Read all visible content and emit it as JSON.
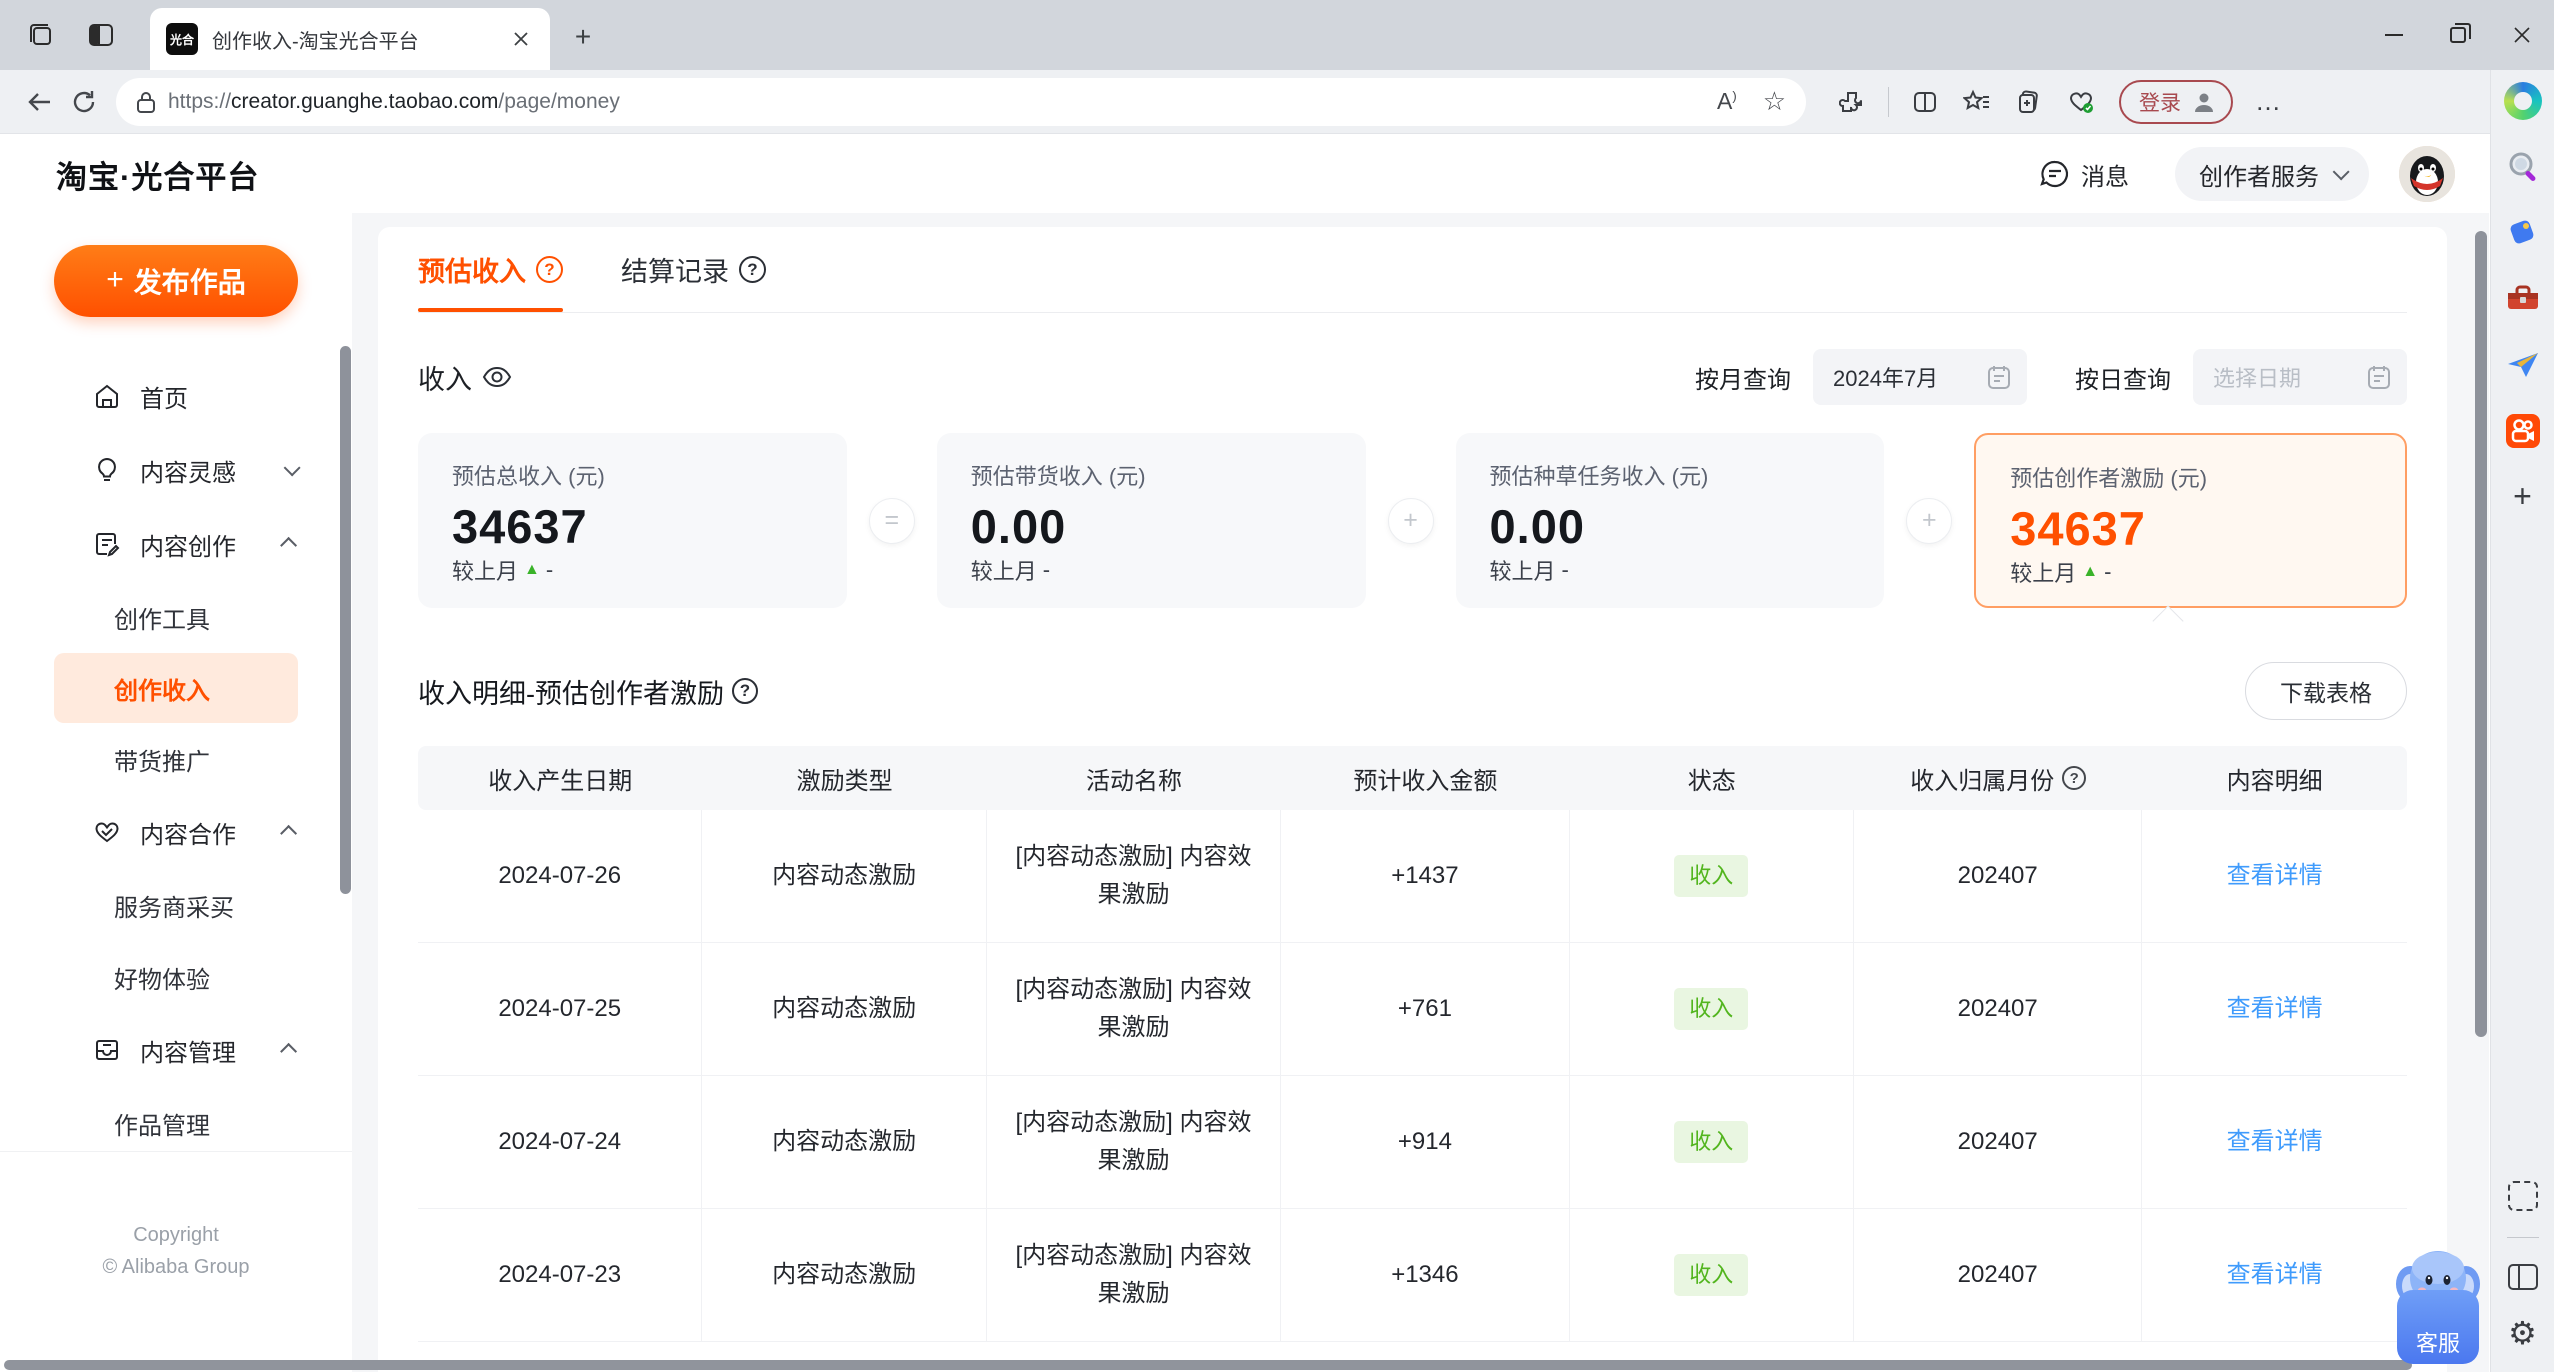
{
  "browser": {
    "tab": {
      "favicon": "光合",
      "title": "创作收入-淘宝光合平台"
    },
    "url": {
      "protocol": "https://",
      "host": "creator.guanghe.taobao.com",
      "path": "/page/money"
    },
    "login_label": "登录"
  },
  "icons": {
    "plus": "+",
    "star": "☆",
    "dots": "…",
    "question": "?",
    "gear": "⚙",
    "read_aloud": "A",
    "up_triangle": "▲"
  },
  "header": {
    "logo": "淘宝·光合平台",
    "messages": "消息",
    "service_menu": "创作者服务"
  },
  "sidebar": {
    "publish_button": "发布作品",
    "items": [
      {
        "label": "首页"
      },
      {
        "label": "内容灵感"
      },
      {
        "label": "内容创作"
      },
      {
        "label": "创作工具"
      },
      {
        "label": "创作收入"
      },
      {
        "label": "带货推广"
      },
      {
        "label": "内容合作"
      },
      {
        "label": "服务商采买"
      },
      {
        "label": "好物体验"
      },
      {
        "label": "内容管理"
      },
      {
        "label": "作品管理"
      }
    ],
    "copyright_line1": "Copyright",
    "copyright_line2": "© Alibaba Group"
  },
  "main": {
    "tabs": [
      {
        "label": "预估收入"
      },
      {
        "label": "结算记录"
      }
    ],
    "income_title": "收入",
    "filters": {
      "month_label": "按月查询",
      "month_value": "2024年7月",
      "day_label": "按日查询",
      "day_placeholder": "选择日期"
    },
    "summary_cards": [
      {
        "label": "预估总收入 (元)",
        "value": "34637",
        "compare_label": "较上月",
        "delta": "-"
      },
      {
        "label": "预估带货收入 (元)",
        "value": "0.00",
        "compare_label": "较上月",
        "delta": "-"
      },
      {
        "label": "预估种草任务收入 (元)",
        "value": "0.00",
        "compare_label": "较上月",
        "delta": "-"
      },
      {
        "label": "预估创作者激励 (元)",
        "value": "34637",
        "compare_label": "较上月",
        "delta": "-"
      }
    ],
    "operators": [
      "=",
      "+",
      "+"
    ],
    "detail": {
      "title": "收入明细-预估创作者激励",
      "download_label": "下载表格"
    },
    "table": {
      "columns": [
        "收入产生日期",
        "激励类型",
        "活动名称",
        "预计收入金额",
        "状态",
        "收入归属月份",
        "内容明细"
      ],
      "rows": [
        {
          "date": "2024-07-26",
          "type": "内容动态激励",
          "activity": "[内容动态激励] 内容效果激励",
          "amount": "+1437",
          "status": "收入",
          "month": "202407",
          "detail": "查看详情"
        },
        {
          "date": "2024-07-25",
          "type": "内容动态激励",
          "activity": "[内容动态激励] 内容效果激励",
          "amount": "+761",
          "status": "收入",
          "month": "202407",
          "detail": "查看详情"
        },
        {
          "date": "2024-07-24",
          "type": "内容动态激励",
          "activity": "[内容动态激励] 内容效果激励",
          "amount": "+914",
          "status": "收入",
          "month": "202407",
          "detail": "查看详情"
        },
        {
          "date": "2024-07-23",
          "type": "内容动态激励",
          "activity": "[内容动态激励] 内容效果激励",
          "amount": "+1346",
          "status": "收入",
          "month": "202407",
          "detail": "查看详情"
        }
      ]
    }
  },
  "widgets": {
    "service_chat": "客服"
  },
  "colors": {
    "accent_orange": "#ff5000",
    "status_green": "#52b51e",
    "link_blue": "#3f9bfc",
    "highlight_card_bg": "#fff8f1",
    "highlight_card_border": "#ff9e63"
  }
}
